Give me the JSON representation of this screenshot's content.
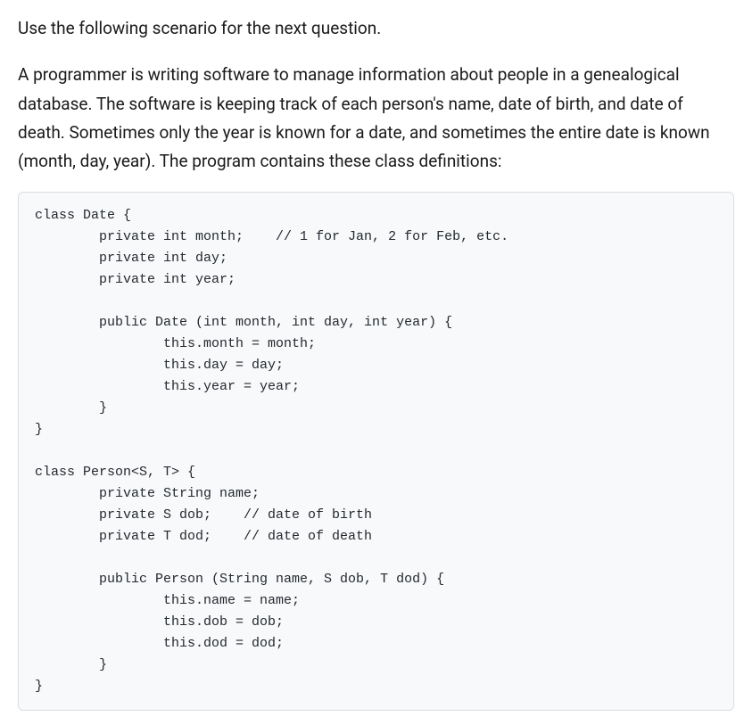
{
  "intro": "Use the following scenario for the next question.",
  "paragraph": "A programmer is writing software to manage information about people in a genealogical database. The software is keeping track of each person's name, date of birth, and date of death. Sometimes only the year is known for a date, and sometimes the entire date is known (month, day, year). The program contains these class definitions:",
  "code": "class Date {\n        private int month;    // 1 for Jan, 2 for Feb, etc.\n        private int day;\n        private int year;\n\n        public Date (int month, int day, int year) {\n                this.month = month;\n                this.day = day;\n                this.year = year;\n        }\n}\n\nclass Person<S, T> {\n        private String name;\n        private S dob;    // date of birth\n        private T dod;    // date of death\n\n        public Person (String name, S dob, T dod) {\n                this.name = name;\n                this.dob = dob;\n                this.dod = dod;\n        }\n}"
}
